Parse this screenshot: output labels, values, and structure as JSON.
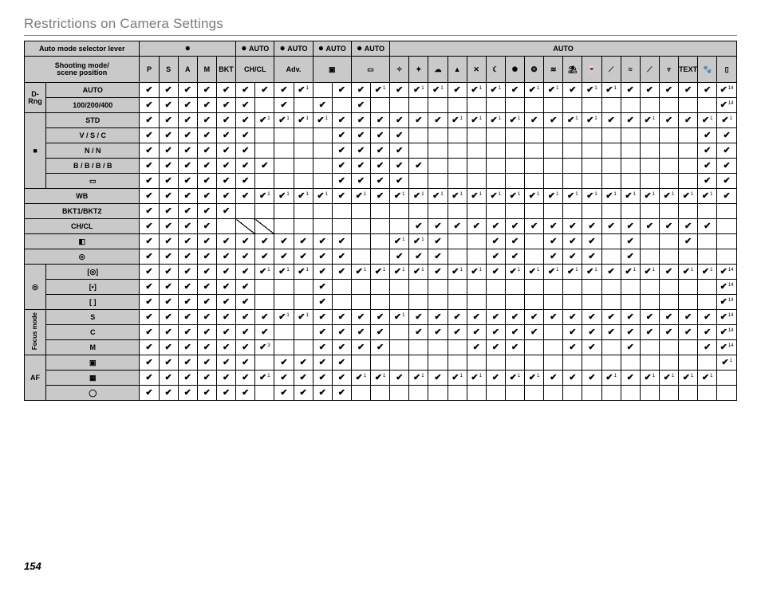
{
  "page": {
    "title": "Restrictions on Camera Settings",
    "number": "154"
  },
  "header": {
    "auto_label": "Auto mode selector lever",
    "shoot_label1": "Shooting mode/",
    "shoot_label2": "scene position",
    "groups": [
      "●",
      "● AUTO",
      "● AUTO",
      "● AUTO",
      "● AUTO",
      "AUTO"
    ],
    "cols": [
      "P",
      "S",
      "A",
      "M",
      "BKT",
      "CH/CL",
      "",
      "Adv.",
      "",
      "▣",
      "",
      "▭",
      "",
      "✧",
      "✦",
      "☁",
      "▲",
      "✕",
      "☾",
      "✺",
      "❂",
      "≋",
      "⛱",
      "🍷",
      "⟋",
      "≈",
      "⟋",
      "▿",
      "TEXT",
      "🐾",
      "▯"
    ],
    "spans": {
      "chcl": 2,
      "adv": 2,
      "box1": 2,
      "box2": 2
    }
  },
  "rows": [
    {
      "cat": "D-Rng",
      "catspan": 2,
      "label": "AUTO",
      "cells": [
        "v",
        "v",
        "v",
        "v",
        "v",
        "v",
        "v",
        "v",
        "v1",
        "",
        "v",
        "v",
        "v1",
        "v",
        "v1",
        "v1",
        "v",
        "v1",
        "v1",
        "v",
        "v1",
        "v1",
        "v",
        "v1",
        "v1",
        "v",
        "v",
        "v",
        "v",
        "v",
        "v14"
      ]
    },
    {
      "label": "100/200/400",
      "cells": [
        "v",
        "v",
        "v",
        "v",
        "v",
        "v",
        "",
        "v",
        "",
        "v",
        "",
        "v",
        "",
        "",
        "",
        "",
        "",
        "",
        "",
        "",
        "",
        "",
        "",
        "",
        "",
        "",
        "",
        "",
        "",
        "",
        "v14"
      ]
    },
    {
      "cat": "■",
      "catspan": 5,
      "label": "STD",
      "cells": [
        "v",
        "v",
        "v",
        "v",
        "v",
        "v",
        "v1",
        "v1",
        "v1",
        "v1",
        "v",
        "v",
        "v",
        "v",
        "v",
        "v",
        "v1",
        "v1",
        "v1",
        "v1",
        "v",
        "v",
        "v1",
        "v1",
        "v",
        "v",
        "v1",
        "v",
        "v",
        "v1",
        "v1"
      ]
    },
    {
      "label": "V / S / C",
      "cells": [
        "v",
        "v",
        "v",
        "v",
        "v",
        "v",
        "",
        "",
        "",
        "",
        "v",
        "v",
        "v",
        "v",
        "",
        "",
        "",
        "",
        "",
        "",
        "",
        "",
        "",
        "",
        "",
        "",
        "",
        "",
        "",
        "v",
        "v"
      ]
    },
    {
      "label": "N / N",
      "cells": [
        "v",
        "v",
        "v",
        "v",
        "v",
        "v",
        "",
        "",
        "",
        "",
        "v",
        "v",
        "v",
        "v",
        "",
        "",
        "",
        "",
        "",
        "",
        "",
        "",
        "",
        "",
        "",
        "",
        "",
        "",
        "",
        "v",
        "v"
      ]
    },
    {
      "label": "B / B / B / B",
      "cells": [
        "v",
        "v",
        "v",
        "v",
        "v",
        "v",
        "v",
        "",
        "",
        "",
        "v",
        "v",
        "v",
        "v",
        "v",
        "",
        "",
        "",
        "",
        "",
        "",
        "",
        "",
        "",
        "",
        "",
        "",
        "",
        "",
        "v",
        "v"
      ]
    },
    {
      "label": "▭",
      "cells": [
        "v",
        "v",
        "v",
        "v",
        "v",
        "v",
        "",
        "",
        "",
        "",
        "v",
        "v",
        "v",
        "v",
        "",
        "",
        "",
        "",
        "",
        "",
        "",
        "",
        "",
        "",
        "",
        "",
        "",
        "",
        "",
        "v",
        "v"
      ]
    },
    {
      "nolabelcat": true,
      "label": "WB",
      "cells": [
        "v",
        "v",
        "v",
        "v",
        "v",
        "v",
        "v1",
        "v1",
        "v1",
        "v1",
        "v",
        "v1",
        "v",
        "v1",
        "v1",
        "v1",
        "v1",
        "v1",
        "v1",
        "v1",
        "v1",
        "v1",
        "v1",
        "v1",
        "v1",
        "v1",
        "v1",
        "v1",
        "v1",
        "v1",
        "v"
      ]
    },
    {
      "nolabelcat": true,
      "label": "BKT1/BKT2",
      "cells": [
        "v",
        "v",
        "v",
        "v",
        "v",
        "",
        "",
        "",
        "",
        "",
        "",
        "",
        "",
        "",
        "",
        "",
        "",
        "",
        "",
        "",
        "",
        "",
        "",
        "",
        "",
        "",
        "",
        "",
        "",
        "",
        ""
      ]
    },
    {
      "nolabelcat": true,
      "label": "CH/CL",
      "cells": [
        "v",
        "v",
        "v",
        "v",
        "",
        "d",
        "d",
        "",
        "",
        "",
        "",
        "",
        "",
        "",
        "v",
        "v",
        "v",
        "v",
        "v",
        "v",
        "v",
        "v",
        "v",
        "v",
        "v",
        "v",
        "v",
        "v",
        "v",
        "v",
        ""
      ]
    },
    {
      "nolabelcat": true,
      "label": "◧",
      "cells": [
        "v",
        "v",
        "v",
        "v",
        "v",
        "v",
        "v",
        "v",
        "v",
        "v",
        "v",
        "",
        "",
        "v1",
        "v1",
        "v",
        "",
        "",
        "v",
        "v",
        "",
        "v",
        "v",
        "v",
        "",
        "v",
        "",
        "",
        "v",
        "",
        ""
      ]
    },
    {
      "nolabelcat": true,
      "label": "◎",
      "cells": [
        "v",
        "v",
        "v",
        "v",
        "v",
        "v",
        "v",
        "v",
        "v",
        "v",
        "v",
        "",
        "",
        "v",
        "v",
        "v",
        "",
        "",
        "v",
        "v",
        "",
        "v",
        "v",
        "v",
        "",
        "v",
        "",
        "",
        "",
        "",
        ""
      ]
    },
    {
      "cat": "◎",
      "catspan": 3,
      "label": "[◎]",
      "cells": [
        "v",
        "v",
        "v",
        "v",
        "v",
        "v",
        "v1",
        "v1",
        "v1",
        "v",
        "v",
        "v1",
        "v1",
        "v1",
        "v1",
        "v",
        "v1",
        "v1",
        "v",
        "v1",
        "v1",
        "v1",
        "v1",
        "v1",
        "v",
        "v1",
        "v1",
        "v",
        "v1",
        "v1",
        "v14"
      ]
    },
    {
      "label": "[•]",
      "cells": [
        "v",
        "v",
        "v",
        "v",
        "v",
        "v",
        "",
        "",
        "",
        "v",
        "",
        "",
        "",
        "",
        "",
        "",
        "",
        "",
        "",
        "",
        "",
        "",
        "",
        "",
        "",
        "",
        "",
        "",
        "",
        "",
        "v14"
      ]
    },
    {
      "label": "[ ]",
      "cells": [
        "v",
        "v",
        "v",
        "v",
        "v",
        "v",
        "",
        "",
        "",
        "v",
        "",
        "",
        "",
        "",
        "",
        "",
        "",
        "",
        "",
        "",
        "",
        "",
        "",
        "",
        "",
        "",
        "",
        "",
        "",
        "",
        "v14"
      ]
    },
    {
      "cat": "Focus mode",
      "catspan": 3,
      "vert": true,
      "label": "S",
      "cells": [
        "v",
        "v",
        "v",
        "v",
        "v",
        "v",
        "v",
        "v1",
        "v1",
        "v",
        "v",
        "v",
        "v",
        "v1",
        "v",
        "v",
        "v",
        "v",
        "v",
        "v",
        "v",
        "v",
        "v",
        "v",
        "v",
        "v",
        "v",
        "v",
        "v",
        "v",
        "v14"
      ]
    },
    {
      "label": "C",
      "cells": [
        "v",
        "v",
        "v",
        "v",
        "v",
        "v",
        "v",
        "",
        "",
        "v",
        "v",
        "v",
        "v",
        "",
        "v",
        "v",
        "v",
        "v",
        "v",
        "v",
        "v",
        "",
        "v",
        "v",
        "v",
        "v",
        "v",
        "v",
        "v",
        "v",
        "v14"
      ]
    },
    {
      "label": "M",
      "cells": [
        "v",
        "v",
        "v",
        "v",
        "v",
        "v",
        "v3",
        "",
        "",
        "v",
        "v",
        "v",
        "v",
        "",
        "",
        "",
        "",
        "v",
        "v",
        "v",
        "",
        "",
        "v",
        "v",
        "",
        "v",
        "",
        "",
        "",
        "v",
        "v14"
      ]
    },
    {
      "cat": "AF",
      "catspan": 3,
      "label": "▣",
      "cells": [
        "v",
        "v",
        "v",
        "v",
        "v",
        "v",
        "",
        "v",
        "v",
        "v",
        "v",
        "",
        "",
        "",
        "",
        "",
        "",
        "",
        "",
        "",
        "",
        "",
        "",
        "",
        "",
        "",
        "",
        "",
        "",
        "",
        "v1"
      ]
    },
    {
      "label": "▦",
      "cells": [
        "v",
        "v",
        "v",
        "v",
        "v",
        "v",
        "v1",
        "v",
        "v",
        "v",
        "v",
        "v1",
        "v1",
        "v",
        "v1",
        "v",
        "v1",
        "v1",
        "v",
        "v1",
        "v1",
        "v",
        "v",
        "v",
        "v1",
        "v",
        "v1",
        "v1",
        "v1",
        "v1",
        ""
      ]
    },
    {
      "label": "◯",
      "cells": [
        "v",
        "v",
        "v",
        "v",
        "v",
        "v",
        "",
        "v",
        "v",
        "v",
        "v",
        "",
        "",
        "",
        "",
        "",
        "",
        "",
        "",
        "",
        "",
        "",
        "",
        "",
        "",
        "",
        "",
        "",
        "",
        "",
        ""
      ]
    }
  ]
}
